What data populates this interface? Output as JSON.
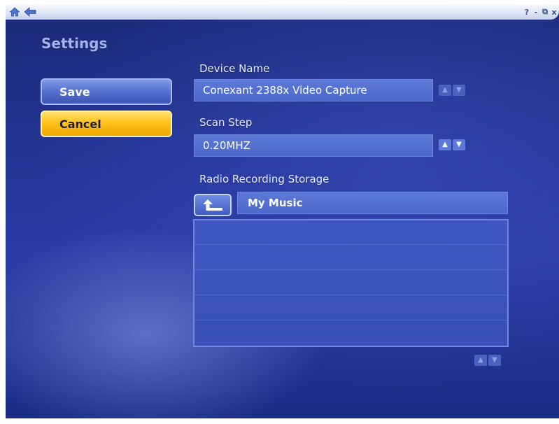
{
  "topbar": {
    "home_icon": "home-icon",
    "back_icon": "back-arrow-icon",
    "help_label": "?",
    "minimize_label": "-",
    "restore_label": "⧉",
    "close_label": "x"
  },
  "page": {
    "title": "Settings"
  },
  "actions": {
    "save_label": "Save",
    "cancel_label": "Cancel"
  },
  "device_name": {
    "label": "Device Name",
    "value": "Conexant 2388x Video Capture",
    "up": "▲",
    "down": "▼"
  },
  "scan_step": {
    "label": "Scan Step",
    "value": "0.20MHZ",
    "up": "▲",
    "down": "▼"
  },
  "storage": {
    "label": "Radio Recording Storage",
    "path": "My Music",
    "up_folder_icon": "up-folder-arrow-icon",
    "list_up": "▲",
    "list_down": "▼"
  },
  "colors": {
    "background": "#2a3ca3",
    "save_button": "#5470cf",
    "cancel_button": "#ffc21c",
    "field": "#5d79d7"
  }
}
